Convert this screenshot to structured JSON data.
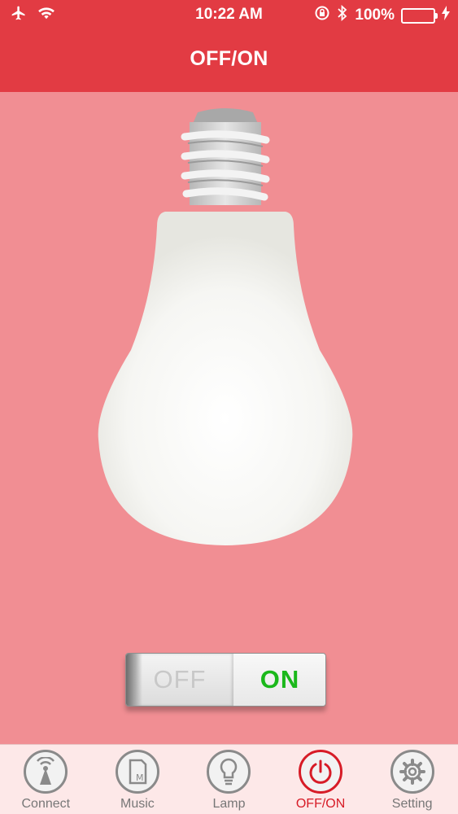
{
  "status_bar": {
    "time": "10:22 AM",
    "battery_percent": "100%",
    "battery_level": 1.0
  },
  "header": {
    "title": "OFF/ON"
  },
  "switch": {
    "off_label": "OFF",
    "on_label": "ON",
    "state": "on"
  },
  "tabs": [
    {
      "label": "Connect",
      "icon": "connect-icon",
      "active": false
    },
    {
      "label": "Music",
      "icon": "music-icon",
      "active": false
    },
    {
      "label": "Lamp",
      "icon": "lamp-icon",
      "active": false
    },
    {
      "label": "OFF/ON",
      "icon": "power-icon",
      "active": true
    },
    {
      "label": "Setting",
      "icon": "setting-icon",
      "active": false
    }
  ],
  "colors": {
    "header": "#e23b43",
    "background": "#f18e93",
    "active_tab": "#d71c27",
    "on_text": "#1bb81b"
  }
}
